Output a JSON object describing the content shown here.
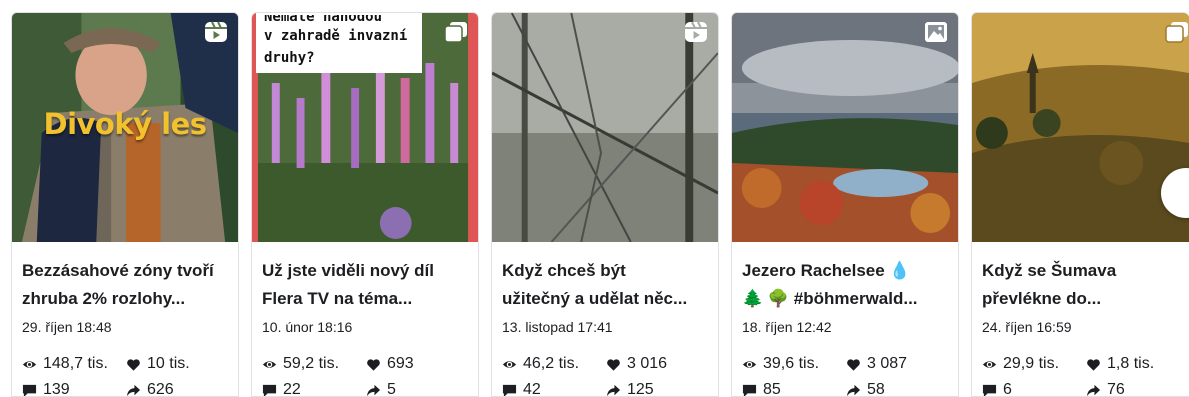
{
  "posts": [
    {
      "title": "Bezzásahové zóny tvoří\nzhruba 2% rozlohy...",
      "date": "29. říjen 18:48",
      "views": "148,7 tis.",
      "likes": "10 tis.",
      "comments": "139",
      "shares": "626",
      "overlay": "Divoký les",
      "media": "reel-icon"
    },
    {
      "title": "Už jste viděli nový díl\nFlera TV na téma...",
      "date": "10. únor 18:16",
      "views": "59,2 tis.",
      "likes": "693",
      "comments": "22",
      "shares": "5",
      "overlay_lines": [
        "Nemáte náhodou",
        "v zahradě invazní",
        "druhy?"
      ],
      "media": "carousel-icon"
    },
    {
      "title": "Když chceš být\nužitečný a udělat něc...",
      "date": "13. listopad 17:41",
      "views": "46,2 tis.",
      "likes": "3 016",
      "comments": "42",
      "shares": "125",
      "media": "reel-icon"
    },
    {
      "title": "Jezero Rachelsee 💧\n🌲 🌳 #böhmerwald...",
      "date": "18. říjen 12:42",
      "views": "39,6 tis.",
      "likes": "3 087",
      "comments": "85",
      "shares": "58",
      "media": "photo-icon"
    },
    {
      "title": "Když se Šumava\npřevlékne do...",
      "date": "24. říjen 16:59",
      "views": "29,9 tis.",
      "likes": "1,8 tis.",
      "comments": "6",
      "shares": "76",
      "media": "carousel-icon"
    }
  ]
}
